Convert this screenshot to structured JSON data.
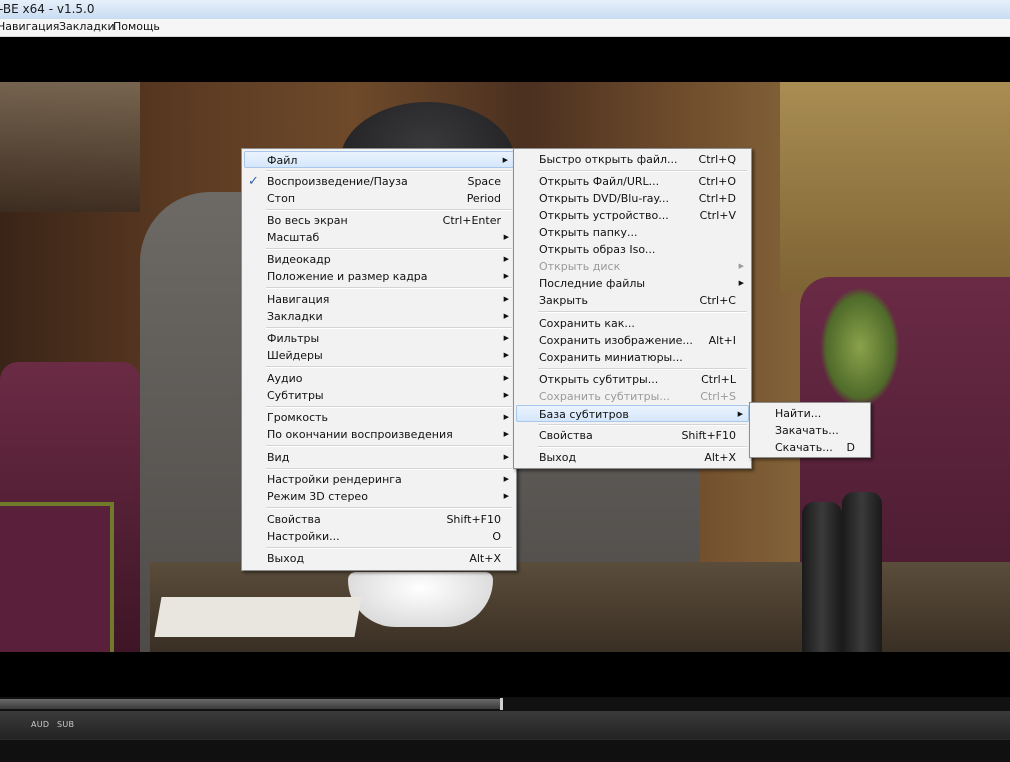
{
  "window": {
    "title": "-BE x64 - v1.5.0"
  },
  "menubar": {
    "items": [
      "Навигация",
      "Закладки",
      "Помощь"
    ]
  },
  "main_menu": {
    "items": [
      {
        "label": "Файл",
        "shortcut": "",
        "submenu": true
      },
      {
        "label": "Воспроизведение/Пауза",
        "shortcut": "Space",
        "checked": true
      },
      {
        "label": "Стоп",
        "shortcut": "Period"
      },
      {
        "label": "Во весь экран",
        "shortcut": "Ctrl+Enter"
      },
      {
        "label": "Масштаб",
        "shortcut": "",
        "submenu": true
      },
      {
        "label": "Видеокадр",
        "shortcut": "",
        "submenu": true
      },
      {
        "label": "Положение и размер кадра",
        "shortcut": "",
        "submenu": true
      },
      {
        "label": "Навигация",
        "shortcut": "",
        "submenu": true
      },
      {
        "label": "Закладки",
        "shortcut": "",
        "submenu": true
      },
      {
        "label": "Фильтры",
        "shortcut": "",
        "submenu": true
      },
      {
        "label": "Шейдеры",
        "shortcut": "",
        "submenu": true
      },
      {
        "label": "Аудио",
        "shortcut": "",
        "submenu": true
      },
      {
        "label": "Субтитры",
        "shortcut": "",
        "submenu": true
      },
      {
        "label": "Громкость",
        "shortcut": "",
        "submenu": true
      },
      {
        "label": "По окончании воспроизведения",
        "shortcut": "",
        "submenu": true
      },
      {
        "label": "Вид",
        "shortcut": "",
        "submenu": true
      },
      {
        "label": "Настройки рендеринга",
        "shortcut": "",
        "submenu": true
      },
      {
        "label": "Режим 3D стерео",
        "shortcut": "",
        "submenu": true
      },
      {
        "label": "Свойства",
        "shortcut": "Shift+F10"
      },
      {
        "label": "Настройки...",
        "shortcut": "O"
      },
      {
        "label": "Выход",
        "shortcut": "Alt+X"
      }
    ]
  },
  "file_menu": {
    "items": [
      {
        "label": "Быстро открыть файл...",
        "shortcut": "Ctrl+Q"
      },
      {
        "label": "Открыть Файл/URL...",
        "shortcut": "Ctrl+O"
      },
      {
        "label": "Открыть DVD/Blu-ray...",
        "shortcut": "Ctrl+D"
      },
      {
        "label": "Открыть устройство...",
        "shortcut": "Ctrl+V"
      },
      {
        "label": "Открыть папку...",
        "shortcut": ""
      },
      {
        "label": "Открыть образ Iso...",
        "shortcut": ""
      },
      {
        "label": "Открыть диск",
        "shortcut": "",
        "submenu": true,
        "disabled": true
      },
      {
        "label": "Последние файлы",
        "shortcut": "",
        "submenu": true
      },
      {
        "label": "Закрыть",
        "shortcut": "Ctrl+C"
      },
      {
        "label": "Сохранить как...",
        "shortcut": ""
      },
      {
        "label": "Сохранить изображение...",
        "shortcut": "Alt+I"
      },
      {
        "label": "Сохранить миниатюры...",
        "shortcut": ""
      },
      {
        "label": "Открыть субтитры...",
        "shortcut": "Ctrl+L"
      },
      {
        "label": "Сохранить субтитры...",
        "shortcut": "Ctrl+S",
        "disabled": true
      },
      {
        "label": "База субтитров",
        "shortcut": "",
        "submenu": true,
        "highlighted": true
      },
      {
        "label": "Свойства",
        "shortcut": "Shift+F10"
      },
      {
        "label": "Выход",
        "shortcut": "Alt+X"
      }
    ]
  },
  "subtitle_db_menu": {
    "items": [
      {
        "label": "Найти...",
        "shortcut": ""
      },
      {
        "label": "Закачать...",
        "shortcut": ""
      },
      {
        "label": "Скачать...",
        "shortcut": "D"
      }
    ]
  },
  "controls": {
    "seek_progress_percent": 49.6,
    "audio_label": "AUD",
    "subtitle_label": "SUB"
  },
  "icons": {
    "check": "checkmark-icon",
    "submenu": "submenu-arrow-icon"
  },
  "colors": {
    "menu_bg": "#f2f2f2",
    "highlight": "#d5e7fb",
    "checkmark": "#3462a8"
  }
}
